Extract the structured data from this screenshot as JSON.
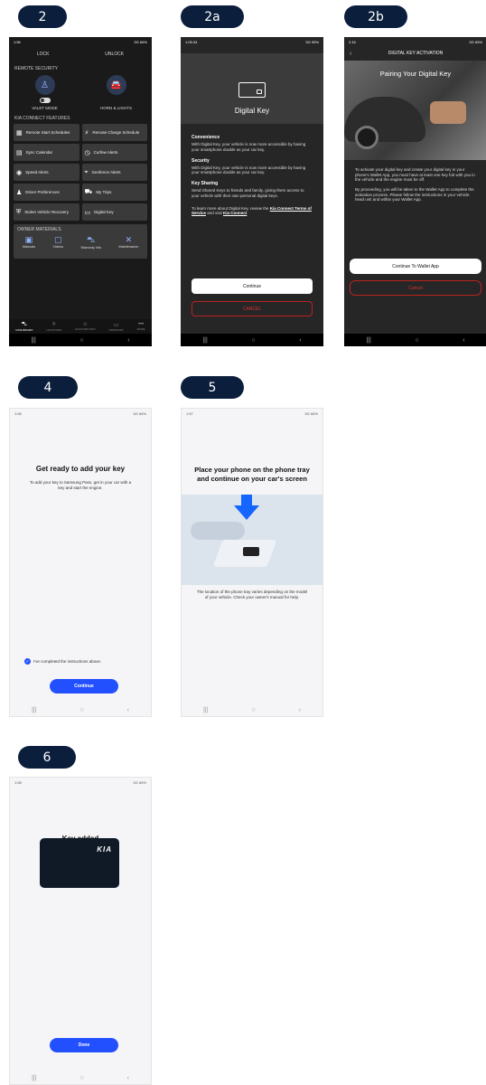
{
  "steps": {
    "s1": "2",
    "s2": "2a",
    "s3": "2b",
    "s4": "4",
    "s5": "5",
    "s6": "6"
  },
  "colors": {
    "badge": "#0b1e3c",
    "blue_button": "#2350ff",
    "cancel_red": "#d33333",
    "dark_bg": "#1a1a1a"
  },
  "phone1": {
    "status_time": "1:56",
    "status_right": "5G 66%",
    "lock": "LOCK",
    "unlock": "UNLOCK",
    "remote_security": "REMOTE SECURITY",
    "valet_mode": "VALET MODE",
    "horn_lights": "HORN & LIGHTS",
    "features_title": "KIA CONNECT FEATURES",
    "tiles": [
      {
        "label": "Remote Start Schedules",
        "icon": "calendar-clock-icon"
      },
      {
        "label": "Remote Charge Schedule",
        "icon": "charge-schedule-icon"
      },
      {
        "label": "Sync Calendar",
        "icon": "calendar-icon"
      },
      {
        "label": "Curfew Alerts",
        "icon": "clock-icon"
      },
      {
        "label": "Speed Alerts",
        "icon": "speed-icon"
      },
      {
        "label": "Geofence Alerts",
        "icon": "geofence-icon"
      },
      {
        "label": "Driver Preferences",
        "icon": "driver-icon"
      },
      {
        "label": "My Trips",
        "icon": "trips-icon"
      },
      {
        "label": "Stolen Vehicle Recovery",
        "icon": "shield-icon"
      },
      {
        "label": "Digital Key",
        "icon": "key-card-icon"
      }
    ],
    "owner_title": "OWNER MATERIALS",
    "owner_items": [
      "Manuals",
      "Videos",
      "Warranty Info",
      "Maintenance"
    ],
    "tabs": [
      "DASHBOARD",
      "LOCATIONS",
      "ACCOUNT INFO",
      "ASSISTANT",
      "MORE"
    ]
  },
  "phone2": {
    "status_time": "1:05:34",
    "status_right": "5G 95%",
    "title": "Digital Key",
    "h_convenience": "Convenience",
    "t_convenience": "With Digital Key, your vehicle is now more accessible by having your smartphone double as your car key.",
    "h_security": "Security",
    "t_security": "With Digital Key, your vehicle is now more accessible by having your smartphone double as your car key.",
    "h_sharing": "Key Sharing",
    "t_sharing": "Send Shared Keys to friends and family, giving them access to your vehicle with their own personal digital keys.",
    "more_prefix": "To learn more about Digital Key, review the ",
    "more_link1": "Kia Connect Terms of Service",
    "more_mid": " and visit ",
    "more_link2": "Kia Connect",
    "continue": "Continue",
    "cancel": "CANCEL"
  },
  "phone3": {
    "status_time": "2:16",
    "status_right": "5G 65%",
    "header": "DIGITAL KEY ACTIVATION",
    "hero_title": "Pairing Your Digital Key",
    "p1": "To activate your digital key and create your digital key in your phone's Wallet App, you must have at least one key fob with you in the vehicle and the engine must be off.",
    "p2": "By proceeding, you will be taken to the Wallet App to complete the activation process. Please follow the instructions in your vehicle head unit and within your Wallet App.",
    "continue": "Continue To Wallet App",
    "cancel": "Cancel"
  },
  "phone4": {
    "status_time": "1:56",
    "status_right": "5G 66%",
    "title": "Get ready to add your key",
    "text": "To add your key to Samsung Pass, get in your car with a key and start the engine.",
    "check": "I've completed the instructions above.",
    "continue": "Continue"
  },
  "phone5": {
    "status_time": "1:57",
    "status_right": "5G 66%",
    "title": "Place your phone on the phone tray and continue on your car's screen",
    "text": "The location of the phone tray varies depending on the model of your vehicle. Check your owner's manual for help."
  },
  "phone6": {
    "status_time": "1:58",
    "status_right": "5G 65%",
    "title": "Key added",
    "logo": "KIA",
    "done": "Done"
  }
}
